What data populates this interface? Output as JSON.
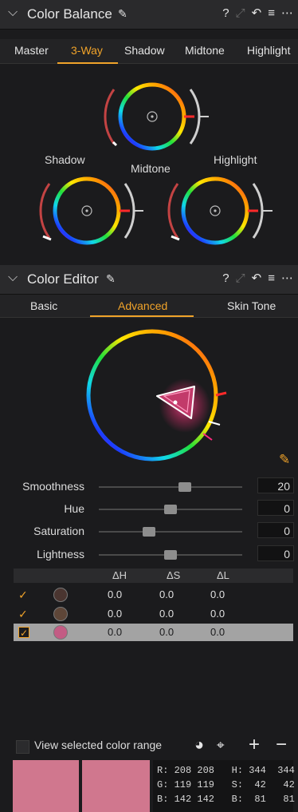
{
  "color_balance": {
    "title": "Color Balance",
    "tabs": [
      "Master",
      "3-Way",
      "Shadow",
      "Midtone",
      "Highlight"
    ],
    "active_tab": "3-Way",
    "wheel_labels": {
      "shadow": "Shadow",
      "midtone": "Midtone",
      "highlight": "Highlight"
    }
  },
  "header_icons": {
    "help": "?",
    "menu": "≡",
    "more": "⋯"
  },
  "color_editor": {
    "title": "Color Editor",
    "tabs": [
      "Basic",
      "Advanced",
      "Skin Tone"
    ],
    "active_tab": "Advanced",
    "sliders": [
      {
        "label": "Smoothness",
        "value": "20",
        "position": 0.6
      },
      {
        "label": "Hue",
        "value": "0",
        "position": 0.5
      },
      {
        "label": "Saturation",
        "value": "0",
        "position": 0.35
      },
      {
        "label": "Lightness",
        "value": "0",
        "position": 0.5
      }
    ],
    "table": {
      "headers": [
        "ΔH",
        "ΔS",
        "ΔL"
      ],
      "rows": [
        {
          "color": "#4a3530",
          "dh": "0.0",
          "ds": "0.0",
          "dl": "0.0",
          "selected": false
        },
        {
          "color": "#5e4638",
          "dh": "0.0",
          "ds": "0.0",
          "dl": "0.0",
          "selected": false
        },
        {
          "color": "#c35c84",
          "dh": "0.0",
          "ds": "0.0",
          "dl": "0.0",
          "selected": true
        }
      ]
    },
    "view_range_label": "View selected color range",
    "add_label": "+",
    "remove_label": "−"
  },
  "color_info": {
    "line1": "R: 208 208   H: 344  344",
    "line2": "G: 119 119   S:  42   42",
    "line3": "B: 142 142   B:  81   81",
    "swatch_color": "#d0778e"
  },
  "colors": {
    "accent": "#f0a32a"
  }
}
